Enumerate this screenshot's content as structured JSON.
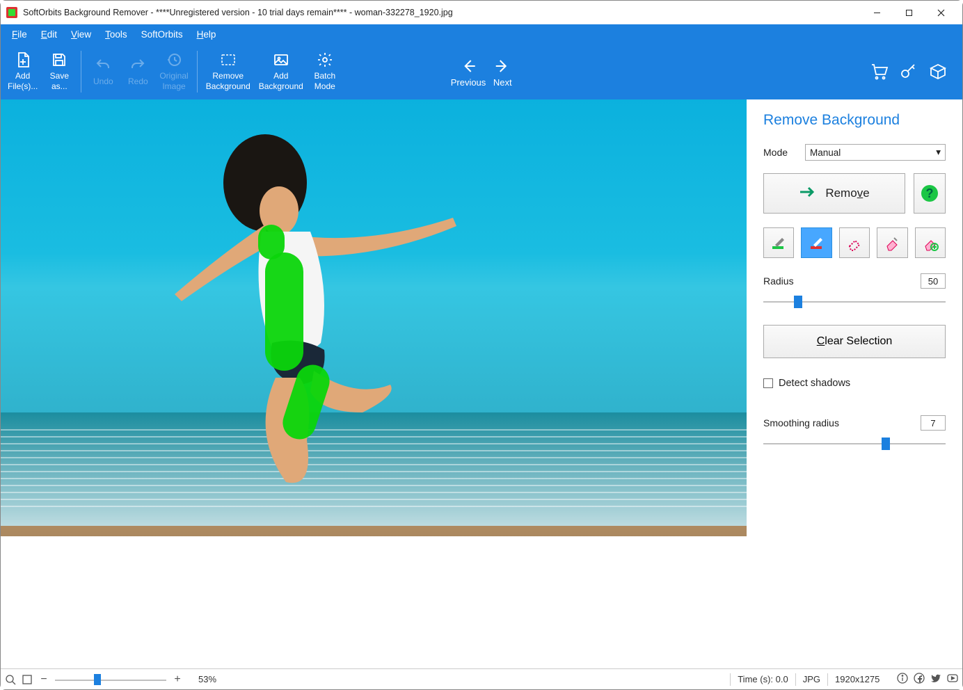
{
  "window": {
    "title": "SoftOrbits Background Remover - ****Unregistered version - 10 trial days remain**** - woman-332278_1920.jpg"
  },
  "menu": {
    "file": "File",
    "edit": "Edit",
    "view": "View",
    "tools": "Tools",
    "softorbits": "SoftOrbits",
    "help": "Help"
  },
  "toolbar": {
    "add_files": "Add\nFile(s)...",
    "save_as": "Save\nas...",
    "undo": "Undo",
    "redo": "Redo",
    "original": "Original\nImage",
    "remove_bg": "Remove\nBackground",
    "add_bg": "Add\nBackground",
    "batch": "Batch\nMode",
    "previous": "Previous",
    "next": "Next"
  },
  "panel": {
    "title": "Remove Background",
    "mode_label": "Mode",
    "mode_value": "Manual",
    "remove_btn": "Remove",
    "radius_label": "Radius",
    "radius_value": "50",
    "clear_btn": "Clear Selection",
    "detect_shadows": "Detect shadows",
    "smoothing_label": "Smoothing radius",
    "smoothing_value": "7"
  },
  "status": {
    "zoom_pct": "53%",
    "time_label": "Time (s): 0.0",
    "format": "JPG",
    "dimensions": "1920x1275"
  }
}
